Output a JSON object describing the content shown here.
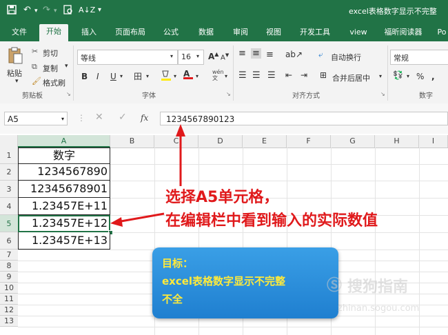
{
  "titlebar": {
    "doc_title": "excel表格数字显示不完整",
    "icons": [
      "save-icon",
      "undo-icon",
      "redo-icon",
      "print-preview-icon",
      "sort-icon",
      "customize-qat-icon"
    ]
  },
  "tabs": [
    {
      "label": "文件"
    },
    {
      "label": "开始"
    },
    {
      "label": "插入"
    },
    {
      "label": "页面布局"
    },
    {
      "label": "公式"
    },
    {
      "label": "数据"
    },
    {
      "label": "审阅"
    },
    {
      "label": "视图"
    },
    {
      "label": "开发工具"
    },
    {
      "label": "view"
    },
    {
      "label": "福昕阅读器"
    },
    {
      "label": "Po"
    }
  ],
  "ribbon": {
    "paste": "粘贴",
    "cut": "剪切",
    "copy": "复制",
    "format_painter": "格式刷",
    "clipboard_group": "剪贴板",
    "font_name": "等线",
    "font_size": "16",
    "font_group": "字体",
    "bold": "B",
    "italic": "I",
    "underline": "U",
    "wrap_text": "自动换行",
    "merge_center": "合并后居中",
    "alignment_group": "对齐方式",
    "number_format": "常规",
    "percent": "%",
    "comma": ",",
    "number_group": "数字",
    "increase_font": "A",
    "decrease_font": "A",
    "font_color_letter": "A",
    "phonetic": "wén\n文"
  },
  "formula_bar": {
    "name_box": "A5",
    "fx": "fx",
    "value": "1234567890123"
  },
  "columns": [
    "A",
    "B",
    "C",
    "D",
    "E",
    "F",
    "G",
    "H",
    "I"
  ],
  "rows": [
    "1",
    "2",
    "3",
    "4",
    "5",
    "6",
    "7",
    "8",
    "9",
    "10",
    "11",
    "12",
    "13"
  ],
  "cells": [
    {
      "row": "1",
      "value": "数字"
    },
    {
      "row": "2",
      "value": "1234567890"
    },
    {
      "row": "3",
      "value": "12345678901"
    },
    {
      "row": "4",
      "value": "1.23457E+11"
    },
    {
      "row": "5",
      "value": "1.23457E+12"
    },
    {
      "row": "6",
      "value": "1.23457E+13"
    }
  ],
  "annotation": {
    "line1": "选择A5单元格，",
    "line2": "在编辑栏中看到输入的实际数值",
    "color": "#e0191b"
  },
  "goal_box": {
    "line1": "目标：",
    "line2": "excel表格数字显示不完整",
    "line3": "不全"
  },
  "watermark": {
    "brand": "搜狗指南",
    "url": "zhinan.sogou.com"
  },
  "colors": {
    "accent": "#217346",
    "annotation": "#e0191b",
    "goal_box": "#2b8ee0",
    "goal_text": "#ffea3b"
  }
}
